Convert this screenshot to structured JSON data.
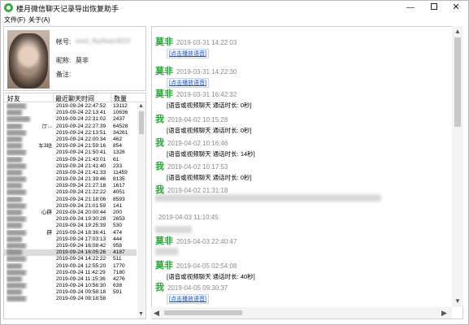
{
  "window": {
    "title": "楼月微信聊天记录导出恢复助手",
    "minimize": "—",
    "close": "✕"
  },
  "menu": {
    "file": "文件(F)",
    "about": "关于(A)"
  },
  "profile": {
    "account_label": "帐号:",
    "account_value": "wxid_fkp6lwjn3633",
    "nickname_label": "昵称:",
    "nickname_value": "莫非",
    "note_label": "备注:"
  },
  "friends": {
    "headers": {
      "name": "好友",
      "time": "最近聊天时间",
      "count": "数量"
    },
    "rows": [
      {
        "name": "▓▓▓▓▓",
        "tail": "",
        "time": "2019-09-24 22:47:52",
        "count": "13112"
      },
      {
        "name": "▓▓▓▓",
        "tail": "",
        "time": "2019-09-24 22:13:41",
        "count": "10636"
      },
      {
        "name": "▓▓▓▓▓▓",
        "tail": "",
        "time": "2019-09-24 22:31:02",
        "count": "2437"
      },
      {
        "name": "▓▓▓▓",
        "tail": "厅...",
        "time": "2019-09-24 22:27:39",
        "count": "64528"
      },
      {
        "name": "▓▓▓▓▓",
        "tail": "",
        "time": "2019-09-24 22:13:51",
        "count": "34261"
      },
      {
        "name": "▓▓▓▓",
        "tail": "",
        "time": "2019-09-24 22:00:34",
        "count": "462"
      },
      {
        "name": "▓▓▓▓",
        "tail": "军3班",
        "time": "2019-09-24 21:59:16",
        "count": "854"
      },
      {
        "name": "▓▓▓▓▓",
        "tail": "",
        "time": "2019-09-24 21:50:41",
        "count": "1326"
      },
      {
        "name": "▓▓▓▓",
        "tail": "",
        "time": "2019-09-24 21:43:01",
        "count": "61"
      },
      {
        "name": "▓▓▓▓▓",
        "tail": "",
        "time": "2019-09-24 21:41:40",
        "count": "233"
      },
      {
        "name": "▓▓▓▓",
        "tail": "",
        "time": "2019-09-24 21:41:33",
        "count": "11459"
      },
      {
        "name": "▓▓▓▓▓",
        "tail": "",
        "time": "2019-09-24 21:39:46",
        "count": "8135"
      },
      {
        "name": "▓▓▓▓",
        "tail": "",
        "time": "2019-09-24 21:27:18",
        "count": "1617"
      },
      {
        "name": "▓▓▓▓▓",
        "tail": "",
        "time": "2019-09-24 21:22:22",
        "count": "4051"
      },
      {
        "name": "▓▓▓▓",
        "tail": "",
        "time": "2019-09-24 21:18:06",
        "count": "8593"
      },
      {
        "name": "▓▓▓▓▓",
        "tail": "",
        "time": "2019-09-24 21:01:59",
        "count": "141"
      },
      {
        "name": "▓▓▓▓",
        "tail": "心群",
        "time": "2019-09-24 20:00:44",
        "count": "200"
      },
      {
        "name": "▓▓▓▓▓",
        "tail": "",
        "time": "2019-09-24 19:30:28",
        "count": "2653"
      },
      {
        "name": "▓▓▓▓",
        "tail": "",
        "time": "2019-09-24 19:25:39",
        "count": "530"
      },
      {
        "name": "▓▓▓▓▓",
        "tail": "群",
        "time": "2019-09-24 18:36:41",
        "count": "474"
      },
      {
        "name": "▓▓▓▓",
        "tail": "",
        "time": "2019-09-24 17:03:13",
        "count": "444"
      },
      {
        "name": "▓▓▓▓▓",
        "tail": "",
        "time": "2019-09-24 16:08:42",
        "count": "958"
      },
      {
        "name": "▓▓▓▓",
        "tail": "",
        "time": "2019-09-24 16:05:26",
        "count": "4187"
      },
      {
        "name": "▓▓▓▓▓",
        "tail": "",
        "time": "2019-09-24 14:22:22",
        "count": "511"
      },
      {
        "name": "▓▓▓▓",
        "tail": "",
        "time": "2019-09-24 12:55:20",
        "count": "1770"
      },
      {
        "name": "▓▓▓▓▓",
        "tail": "",
        "time": "2019-09-24 11:42:29",
        "count": "7180"
      },
      {
        "name": "▓▓▓▓",
        "tail": "",
        "time": "2019-09-24 11:15:36",
        "count": "4276"
      },
      {
        "name": "▓▓▓▓▓",
        "tail": "",
        "time": "2019-09-24 10:56:30",
        "count": "638"
      },
      {
        "name": "▓▓▓▓",
        "tail": "",
        "time": "2019-09-24 09:58:18",
        "count": "591"
      },
      {
        "name": "▓▓▓▓▓",
        "tail": "",
        "time": "2019-09-24 08:18:58",
        "count": ""
      }
    ]
  },
  "chat": {
    "messages": [
      {
        "sender": "莫非",
        "time": "2019-03-31 14:22:03",
        "link": "[点击播放语音]"
      },
      {
        "sender": "莫非",
        "time": "2019-03-31 14:22:30",
        "link": "[点击播放语音]"
      },
      {
        "sender": "莫非",
        "time": "2019-03-31 16:42:32",
        "text": "[语音或视频聊天 通话时长: 0秒]"
      },
      {
        "sender": "我",
        "time": "2019-04-02 10:15:28",
        "text": "[语音或视频聊天 通话时长: 0秒]"
      },
      {
        "sender": "我",
        "time": "2019-04-02 10:16:46",
        "text": "[语音或视频聊天 通话时长: 14秒]"
      },
      {
        "sender": "我",
        "time": "2019-04-02 10:17:53",
        "text": "[语音或视频聊天 通话时长: 0秒]"
      },
      {
        "sender": "我",
        "time": "2019-04-02 21:31:18",
        "text": ""
      },
      {
        "sender": "",
        "time": "2019-04-03 11:10:45",
        "text": ""
      },
      {
        "sender": "莫非",
        "time": "2019-04-03 22:40:47",
        "text": ""
      },
      {
        "sender": "莫非",
        "time": "2019-04-05 02:54:08",
        "text": "[语音或视频聊天 通话时长: 40秒]"
      },
      {
        "sender": "我",
        "time": "2019-04-05 09:30:37",
        "link": "[点击播放语音]"
      }
    ]
  }
}
